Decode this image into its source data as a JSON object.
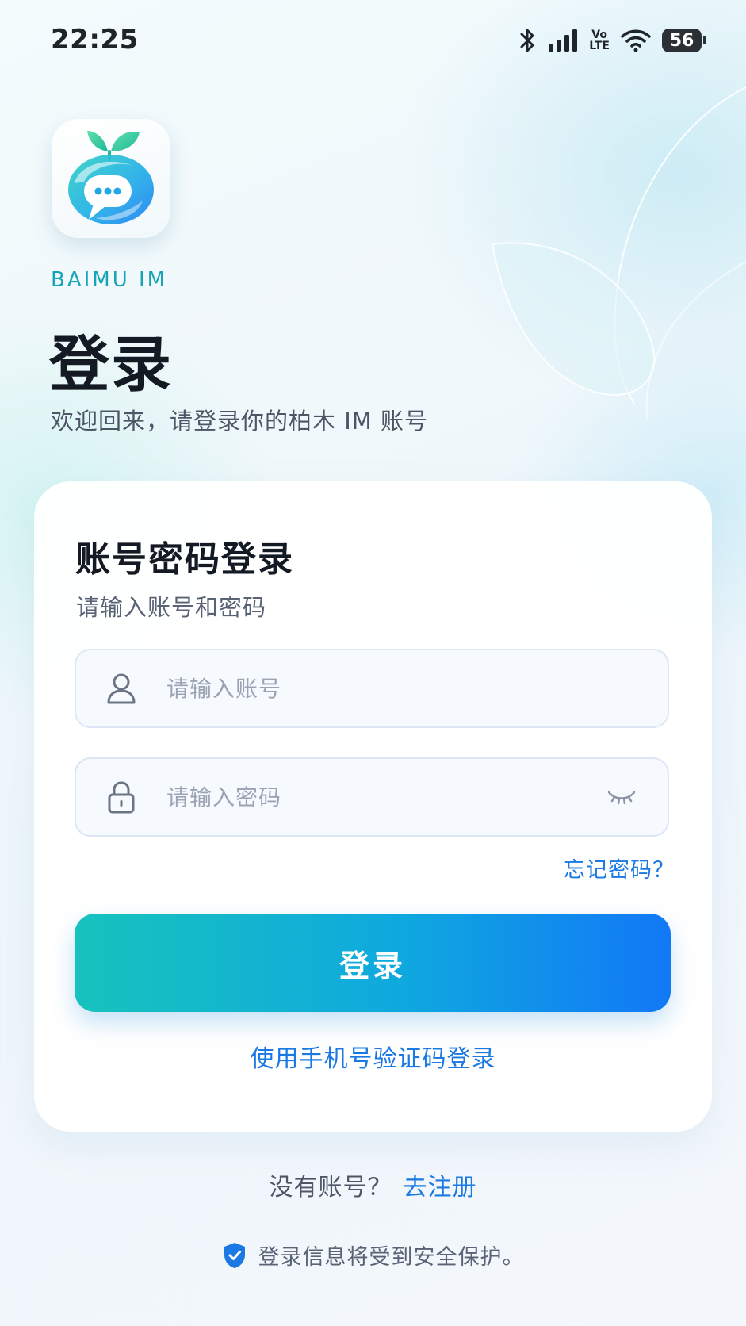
{
  "status_bar": {
    "time": "22:25",
    "volte_top": "Vo",
    "volte_bottom": "LTE",
    "battery": "56",
    "icons": [
      "bluetooth-icon",
      "signal-icon",
      "volte-icon",
      "wifi-icon",
      "battery-icon"
    ]
  },
  "app": {
    "logo_icon": "chat-bubble-leaf-logo",
    "brand_label": "BAIMU IM"
  },
  "header": {
    "title": "登录",
    "welcome": "欢迎回来，请登录你的柏木 IM 账号"
  },
  "card": {
    "title": "账号密码登录",
    "subtitle": "请输入账号和密码",
    "account": {
      "icon": "user-icon",
      "placeholder": "请输入账号",
      "value": ""
    },
    "password": {
      "icon": "lock-icon",
      "placeholder": "请输入密码",
      "value": "",
      "toggle_icon": "eye-closed-icon"
    },
    "forgot_label": "忘记密码？",
    "login_button_label": "登录",
    "sms_login_label": "使用手机号验证码登录"
  },
  "footer": {
    "no_account": "没有账号？",
    "register_label": "去注册",
    "security_icon": "shield-check-icon",
    "security_note": "登录信息将受到安全保护。"
  },
  "colors": {
    "accent": "#1b79e3",
    "brand_teal": "#16a5b5",
    "button_gradient_start": "#17c3bd",
    "button_gradient_end": "#1278f6",
    "title": "#141a24"
  }
}
